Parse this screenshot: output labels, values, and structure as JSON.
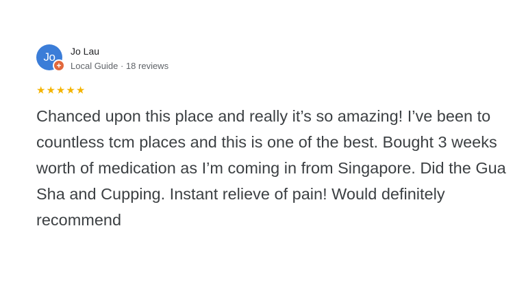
{
  "reviewer": {
    "initials": "Jo",
    "name": "Jo Lau",
    "subtitle": "Local Guide · 18 reviews",
    "avatar_color": "#3b7dd8",
    "badge_color": "#e2683c",
    "badge_icon": "local-guide-badge-icon"
  },
  "rating": {
    "stars": 5,
    "max": 5,
    "star_color": "#f4b400",
    "star_glyph": "★"
  },
  "review": {
    "text": "Chanced upon this place and really it’s so amazing! I’ve been to countless tcm places and this is one of the best. Bought 3 weeks worth of medication as I’m coming in from Singapore. Did the Gua Sha and Cupping. Instant relieve of pain! Would definitely recommend"
  }
}
